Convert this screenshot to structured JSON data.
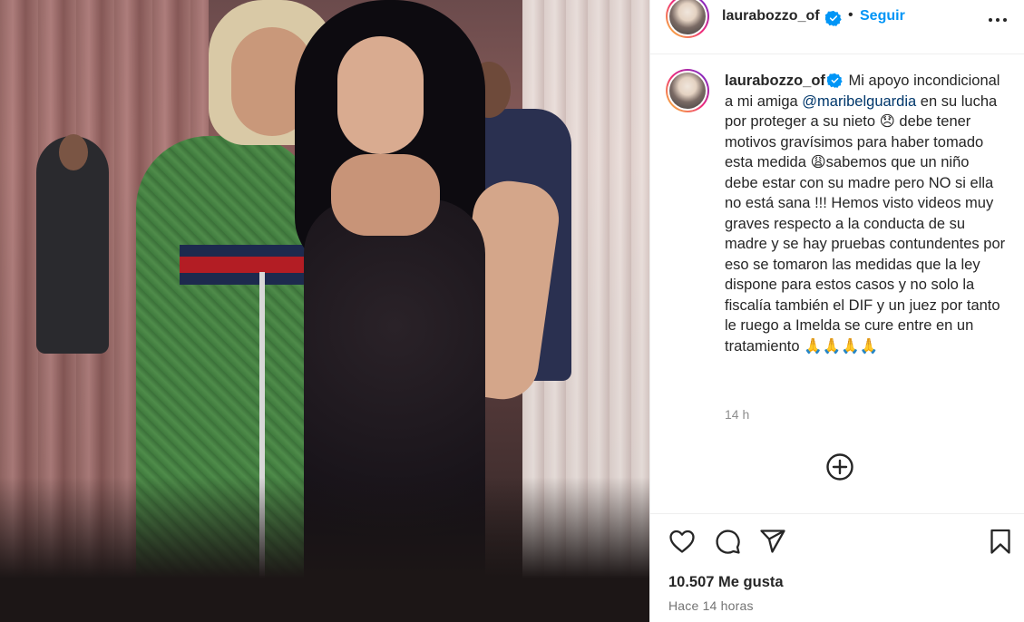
{
  "post": {
    "photo_alt": "",
    "header": {
      "username": "laurabozzo_of",
      "separator": "•",
      "follow_label": "Seguir"
    },
    "caption": {
      "username": "laurabozzo_of",
      "text_1": "Mi apoyo incondicional a mi amiga",
      "mention": "@maribelguardia",
      "text_2": "en su lucha por proteger a su nieto 😞 debe tener motivos gravísimos para haber tomado esta medida 😩sabemos que un niño debe estar con su madre pero NO si ella no está sana !!! Hemos visto videos muy graves respecto a la conducta de su madre y se hay pruebas contundentes por eso se tomaron las medidas que la ley dispone para estos casos y no solo la fiscalía también el DIF y un juez por tanto le ruego a Imelda se cure entre en un tratamiento 🙏🙏🙏🙏",
      "time": "14 h"
    },
    "likes": "10.507 Me gusta",
    "post_time": "Hace 14 horas"
  },
  "colors": {
    "follow_blue": "#0095f6",
    "mention_blue": "#00376b",
    "verified_blue": "#0095f6",
    "text": "#262626",
    "muted": "#8e8e8e"
  },
  "icons": {
    "verified": "verified-badge-icon",
    "more": "more-options-icon",
    "add_comment": "plus-circle-icon",
    "like": "heart-icon",
    "comment": "comment-bubble-icon",
    "share": "paper-plane-icon",
    "save": "bookmark-icon"
  }
}
